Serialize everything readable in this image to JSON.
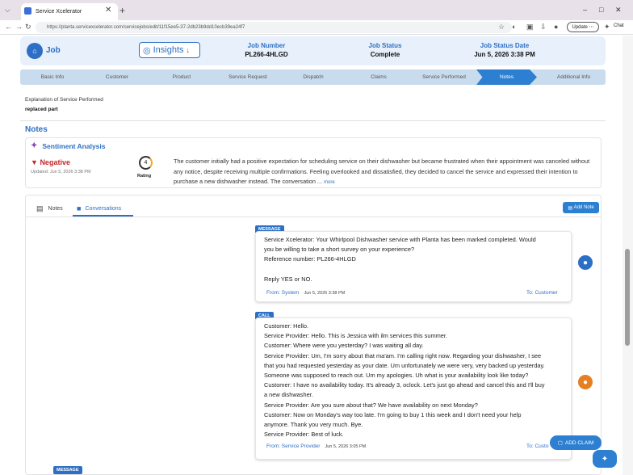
{
  "browser": {
    "tab_title": "Service Xcelerator",
    "url": "https://planta.servicexcelerator.com/servicejobs/edit/11f15ee5-37-2db23b9dd10ecb39ea24f7",
    "update_label": "Update",
    "chat_label": "Chat"
  },
  "header": {
    "job_label": "Job",
    "insights_label": "Insights",
    "job_number_title": "Job Number",
    "job_number": "PL266-4HLGD",
    "job_status_title": "Job Status",
    "job_status": "Complete",
    "job_status_date_title": "Job Status Date",
    "job_status_date": "Jun 5, 2026 3:38 PM"
  },
  "steps": [
    "Basic Info",
    "Customer",
    "Product",
    "Service Request",
    "Dispatch",
    "Claims",
    "Service Performed",
    "Notes",
    "Additional Info"
  ],
  "explanation": {
    "label": "Explanation of Service Performed",
    "value": "replaced part"
  },
  "notes": {
    "title": "Notes",
    "sentiment_title": "Sentiment Analysis",
    "sentiment": "Negative",
    "updated": "Updated: Jun 5, 2026 3:38 PM",
    "rating": "4",
    "rating_label": "Rating",
    "summary": "The customer initially had a positive expectation for scheduling service on their dishwasher but became frustrated when their appointment was canceled without any notice, despite receiving multiple confirmations. Feeling overlooked and dissatisfied, they decided to cancel the service and expressed their intention to purchase a new dishwasher instead. The conversation ...",
    "more_label": "more"
  },
  "tabs": {
    "notes": "Notes",
    "conversations": "Conversations",
    "add_note": "Add Note"
  },
  "messages": [
    {
      "badge": "MESSAGE",
      "lines": [
        "Service Xcelerator: Your Whirlpool Dishwasher service with Planta has been marked completed. Would",
        "you be willing to take a short survey on your experience?",
        "Reference number: PL266-4HLGD",
        "",
        "Reply YES or NO."
      ],
      "from": "From: System",
      "date": "Jun 5, 2026 3:38 PM",
      "to": "To: Customer"
    },
    {
      "badge": "CALL",
      "lines": [
        "Customer: Hello.",
        "Service Provider: Hello. This is Jessica with ilm services this summer.",
        "Customer: Where were you yesterday? I was waiting all day.",
        "Service Provider: Um, I'm sorry about that ma'am. I'm calling right now. Regarding your dishwasher, I see",
        "that you had requested yesterday as your date. Um unfortunately we were very, very backed up yesterday.",
        "Someone was supposed to reach out. Um my apologies. Uh what is your availability look like today?",
        "Customer: I have no availability today. It's already 3, oclock. Let's just go ahead and cancel this and I'll buy",
        "a new dishwasher.",
        "Service Provider: Are you sure about that? We have availability on next Monday?",
        "Customer: Now on Monday's way too late. I'm going to buy 1 this week and I don't need your help",
        "anymore. Thank you very much. Bye.",
        "Service Provider: Best of luck."
      ],
      "from": "From: Service Provider",
      "date": "Jun 5, 2026 3:05 PM",
      "to": "To: Custo"
    }
  ],
  "next_badge": "MESSAGE",
  "add_claim": "ADD CLAIM",
  "colors": {
    "accent": "#2d6fc4",
    "negative": "#c62828",
    "caller_avatar": "#e67e22"
  }
}
